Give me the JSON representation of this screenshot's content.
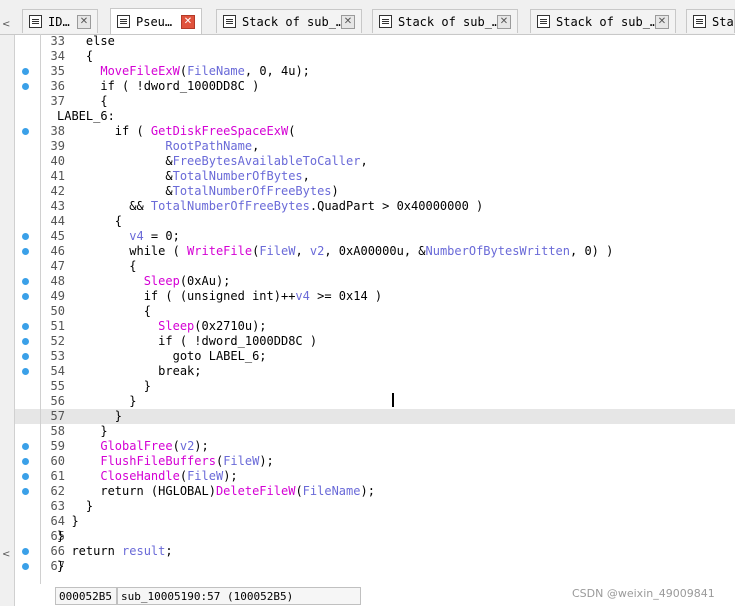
{
  "tabs": [
    {
      "label": "ID…",
      "icon": "ida-view-icon",
      "closable": true
    },
    {
      "label": "Pseu…",
      "icon": "pseudocode-icon",
      "closable": true,
      "active": true
    },
    {
      "label": "Stack of sub_…",
      "icon": "stack-view-icon",
      "closable": true
    },
    {
      "label": "Stack of sub_…",
      "icon": "stack-view-icon",
      "closable": true
    },
    {
      "label": "Stack of sub_…",
      "icon": "stack-view-icon",
      "closable": true
    },
    {
      "label": "Sta",
      "icon": "stack-view-icon",
      "closable": false
    }
  ],
  "left_strip": {
    "top_glyph": "<",
    "bottom_glyph": "<"
  },
  "code_lines": [
    {
      "num": "33",
      "dot": false,
      "html": "    else"
    },
    {
      "num": "34",
      "dot": false,
      "html": "    {"
    },
    {
      "num": "35",
      "dot": true,
      "html": "      <span class=\"fn\">MoveFileExW</span>(<span class=\"var\">FileName</span>, 0, 4u);"
    },
    {
      "num": "36",
      "dot": true,
      "html": "      if ( !dword_1000DD8C )"
    },
    {
      "num": "37",
      "dot": false,
      "html": "      {"
    },
    {
      "num": "",
      "dot": false,
      "html": "LABEL_6:"
    },
    {
      "num": "38",
      "dot": true,
      "html": "        if ( <span class=\"fn\">GetDiskFreeSpaceExW</span>("
    },
    {
      "num": "39",
      "dot": false,
      "html": "               <span class=\"var\">RootPathName</span>,"
    },
    {
      "num": "40",
      "dot": false,
      "html": "               &amp;<span class=\"var\">FreeBytesAvailableToCaller</span>,"
    },
    {
      "num": "41",
      "dot": false,
      "html": "               &amp;<span class=\"var\">TotalNumberOfBytes</span>,"
    },
    {
      "num": "42",
      "dot": false,
      "html": "               &amp;<span class=\"var\">TotalNumberOfFreeBytes</span>)"
    },
    {
      "num": "43",
      "dot": false,
      "html": "          &amp;&amp; <span class=\"var\">TotalNumberOfFreeBytes</span>.QuadPart &gt; 0x40000000 )"
    },
    {
      "num": "44",
      "dot": false,
      "html": "        {"
    },
    {
      "num": "45",
      "dot": true,
      "html": "          <span class=\"var\">v4</span> = 0;"
    },
    {
      "num": "46",
      "dot": true,
      "html": "          while ( <span class=\"fn\">WriteFile</span>(<span class=\"var\">FileW</span>, <span class=\"var\">v2</span>, 0xA00000u, &amp;<span class=\"var\">NumberOfBytesWritten</span>, 0) )"
    },
    {
      "num": "47",
      "dot": false,
      "html": "          {"
    },
    {
      "num": "48",
      "dot": true,
      "html": "            <span class=\"fn\">Sleep</span>(0xAu);"
    },
    {
      "num": "49",
      "dot": true,
      "html": "            if ( (unsigned int)++<span class=\"var\">v4</span> &gt;= 0x14 )"
    },
    {
      "num": "50",
      "dot": false,
      "html": "            {"
    },
    {
      "num": "51",
      "dot": true,
      "html": "              <span class=\"fn\">Sleep</span>(0x2710u);"
    },
    {
      "num": "52",
      "dot": true,
      "html": "              if ( !dword_1000DD8C )"
    },
    {
      "num": "53",
      "dot": true,
      "html": "                goto LABEL_6;"
    },
    {
      "num": "54",
      "dot": true,
      "html": "              break;"
    },
    {
      "num": "55",
      "dot": false,
      "html": "            }"
    },
    {
      "num": "56",
      "dot": false,
      "html": "          }"
    },
    {
      "num": "57",
      "dot": false,
      "html": "        }"
    },
    {
      "num": "58",
      "dot": false,
      "html": "      }"
    },
    {
      "num": "59",
      "dot": true,
      "html": "      <span class=\"fn\">GlobalFree</span>(<span class=\"var\">v2</span>);"
    },
    {
      "num": "60",
      "dot": true,
      "html": "      <span class=\"fn\">FlushFileBuffers</span>(<span class=\"var\">FileW</span>);"
    },
    {
      "num": "61",
      "dot": true,
      "html": "      <span class=\"fn\">CloseHandle</span>(<span class=\"var\">FileW</span>);"
    },
    {
      "num": "62",
      "dot": true,
      "html": "      return (HGLOBAL)<span class=\"fn\">DeleteFileW</span>(<span class=\"var\">FileName</span>);"
    },
    {
      "num": "63",
      "dot": false,
      "html": "    }"
    },
    {
      "num": "64",
      "dot": false,
      "html": "  }"
    },
    {
      "num": "65",
      "dot": false,
      "html": "}"
    },
    {
      "num": "66",
      "dot": true,
      "html": "  return <span class=\"var\">result</span>;"
    },
    {
      "num": "67",
      "dot": true,
      "html": "}"
    }
  ],
  "highlighted_line": "57",
  "status": {
    "address": "000052B5",
    "location": "sub_10005190:57 (100052B5)"
  },
  "watermark": "CSDN @weixin_49009841",
  "colors": {
    "function": "#d400d4",
    "variable": "#6a6ad8",
    "breakpoint_dot": "#3aa0e8",
    "highlight_line": "#e6e6e6",
    "close_active": "#e0523c"
  }
}
